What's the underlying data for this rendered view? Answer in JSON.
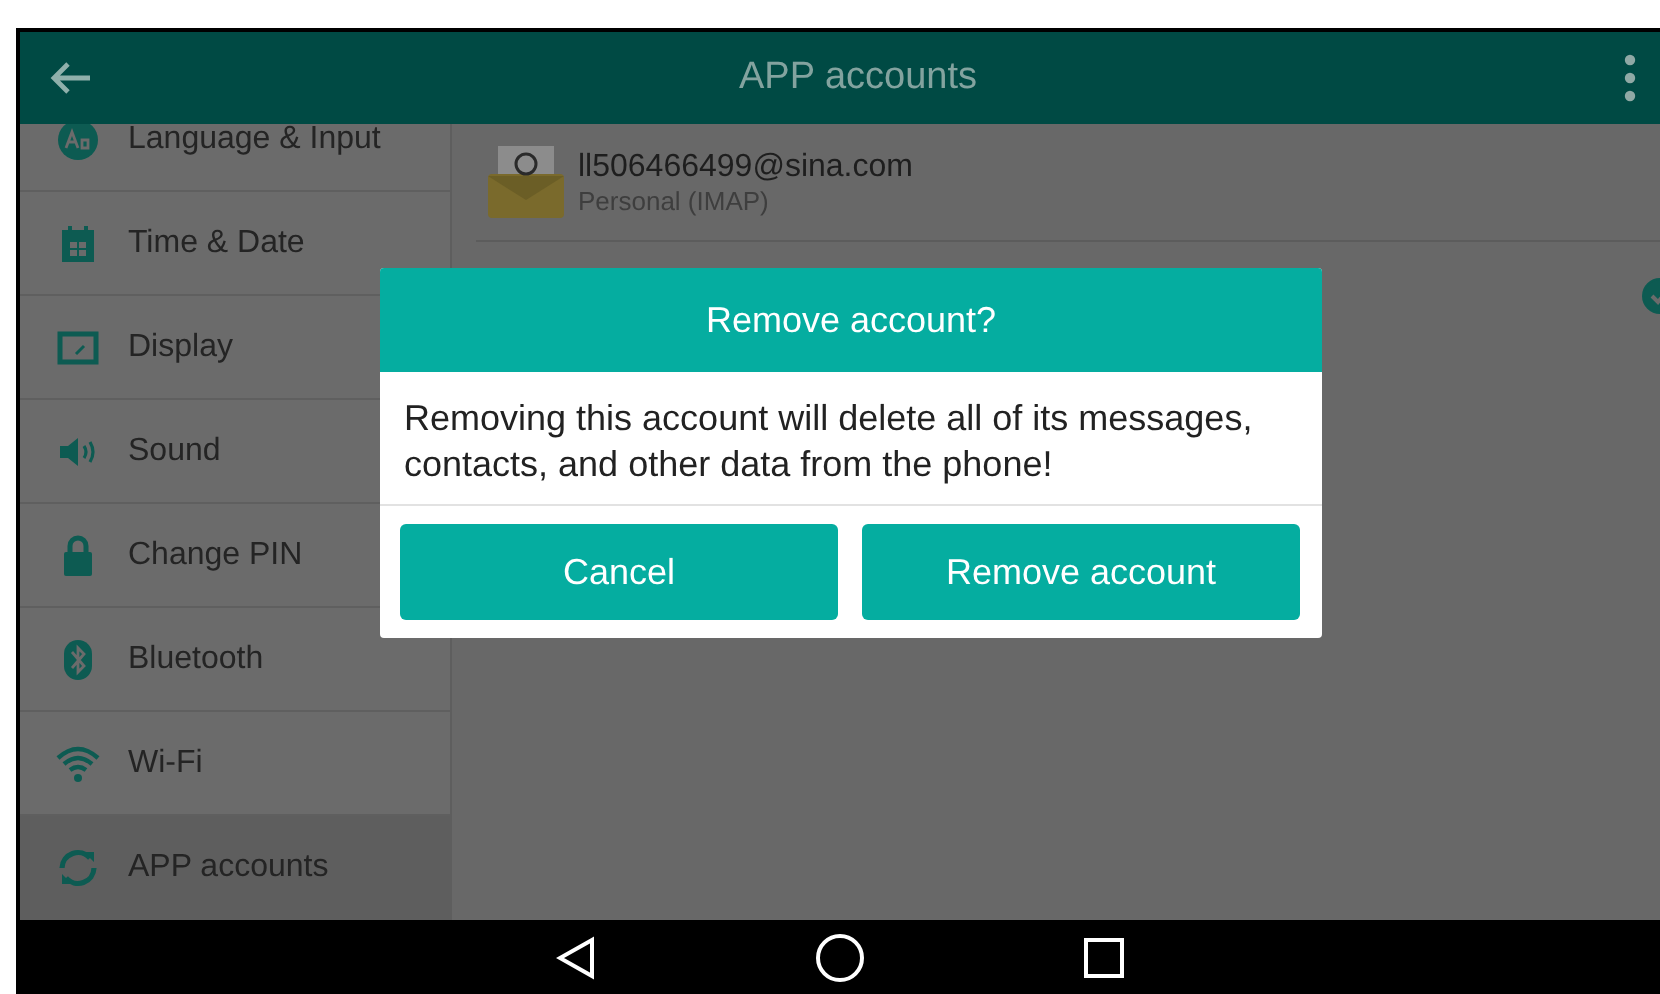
{
  "title_bar": {
    "title": "APP accounts"
  },
  "sidebar": {
    "items": [
      {
        "label": "Language & Input",
        "selected": false
      },
      {
        "label": "Time & Date",
        "selected": false
      },
      {
        "label": "Display",
        "selected": false
      },
      {
        "label": "Sound",
        "selected": false
      },
      {
        "label": "Change PIN",
        "selected": false
      },
      {
        "label": "Bluetooth",
        "selected": false
      },
      {
        "label": "Wi-Fi",
        "selected": false
      },
      {
        "label": "APP accounts",
        "selected": true
      }
    ]
  },
  "account": {
    "address": "ll506466499@sina.com",
    "type": "Personal (IMAP)",
    "sync_checked": true
  },
  "dialog": {
    "title": "Remove account?",
    "message": "Removing this account will delete all of its messages, contacts, and other data from the phone!",
    "buttons": [
      "Cancel",
      "Remove account"
    ]
  }
}
